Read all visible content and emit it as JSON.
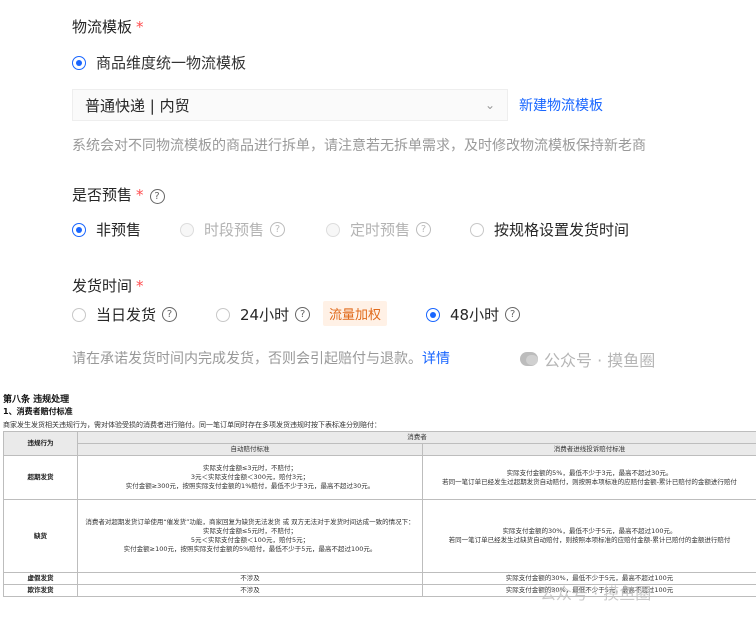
{
  "logistics": {
    "label": "物流模板",
    "required": "*",
    "option": "商品维度统一物流模板",
    "select_value": "普通快递 | 内贸",
    "create_link": "新建物流模板",
    "notice": "系统会对不同物流模板的商品进行拆单，请注意若无拆单需求，及时修改物流模板保持新老商"
  },
  "presale": {
    "label": "是否预售",
    "required": "*",
    "help": "?",
    "options": [
      {
        "label": "非预售",
        "state": "selected"
      },
      {
        "label": "时段预售",
        "state": "disabled"
      },
      {
        "label": "定时预售",
        "state": "disabled"
      },
      {
        "label": "按规格设置发货时间",
        "state": "normal"
      }
    ]
  },
  "ship_time": {
    "label": "发货时间",
    "required": "*",
    "options": [
      {
        "label": "当日发货",
        "state": "normal"
      },
      {
        "label": "24小时",
        "state": "normal"
      },
      {
        "label": "48小时",
        "state": "selected"
      }
    ],
    "tag": "流量加权",
    "hint": "请在承诺发货时间内完成发货，否则会引起赔付与退款。",
    "hint_link": "详情",
    "watermark": "公众号 · 摸鱼圈"
  },
  "doc": {
    "article": "第八条 违规处理",
    "section": "1、消费者赔付标准",
    "intro": "商家发生发货相关违规行为，需对体验受损的消费者进行赔付。同一笔订单同时存在多项发货违规时按下表标准分别赔付：",
    "table": {
      "col_behavior": "违规行为",
      "col_consumer": "消费者",
      "col_auto": "自动赔付标准",
      "col_complaint": "消费者进线投诉赔付标准",
      "rows": [
        {
          "behavior": "超期发货",
          "auto": [
            "实际支付金额≤3元时，不赔付；",
            "3元＜实际支付金额＜300元，赔付3元；",
            "实付金额≥300元，按照实际支付金额的1%赔付，最低不少于3元，最高不超过30元。"
          ],
          "complaint": [
            "实际支付金额的5%，最低不少于3元，最高不超过30元。",
            "若同一笔订单已经发生过超期发货自动赔付，则按照本项标准的应赔付金额-累计已赔付的金额进行赔付"
          ]
        },
        {
          "behavior": "缺货",
          "auto": [
            "消费者对超期发货订单使用“催发货”功能，商家回复为缺货无法发货 或 双方无法对于发货时间达成一致的情况下：",
            "实际支付金额≤5元时，不赔付；",
            "5元＜实际支付金额＜100元，赔付5元；",
            "实付金额≥100元，按照实际支付金额的5%赔付，最低不少于5元，最高不超过100元。"
          ],
          "complaint": [
            "实际支付金额的30%，最低不少于5元，最高不超过100元。",
            "若同一笔订单已经发生过缺货自动赔付，则按照本项标准的应赔付金额-累计已赔付的金额进行赔付"
          ]
        },
        {
          "behavior": "虚假发货",
          "auto": [
            "不涉及"
          ],
          "complaint": [
            "实际支付金额的30%，最低不少于5元，最高不超过100元"
          ]
        },
        {
          "behavior": "欺诈发货",
          "auto": [
            "不涉及"
          ],
          "complaint": [
            "实际支付金额的30%，最低不少于5元，最高不超过100元"
          ]
        }
      ]
    },
    "watermark": "公众号 · 摸鱼圈"
  }
}
